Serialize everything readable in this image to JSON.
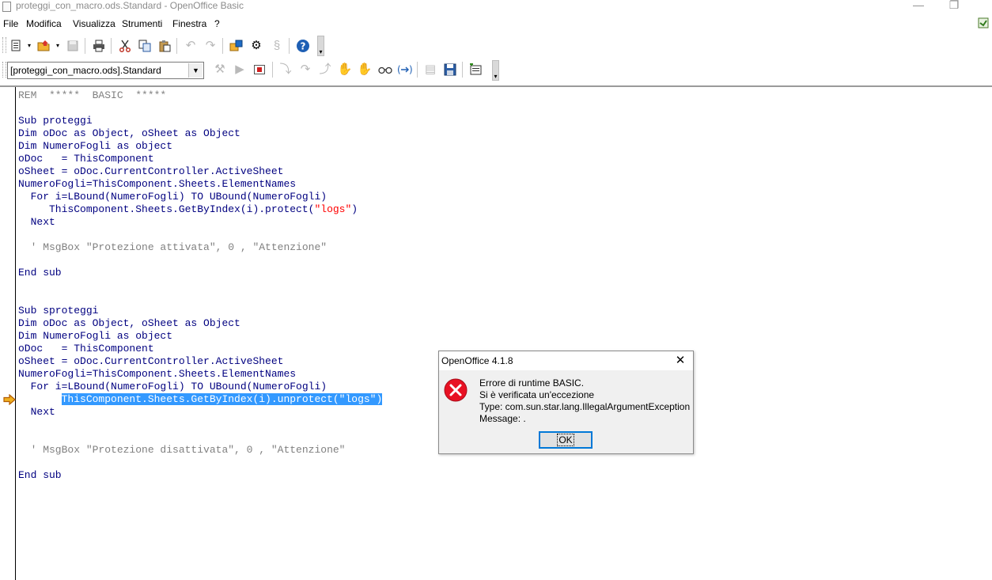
{
  "window": {
    "title": "proteggi_con_macro.ods.Standard - OpenOffice Basic",
    "minimize_glyph": "—",
    "restore_glyph": "❐"
  },
  "menu": [
    "File",
    "Modifica",
    "Visualizza",
    "Strumenti",
    "Finestra",
    "?"
  ],
  "toolbar2": {
    "library_value": "[proteggi_con_macro.ods].Standard"
  },
  "code": {
    "lines": [
      [
        {
          "t": "REM  *****  BASIC  *****",
          "c": "cm"
        }
      ],
      [],
      [
        {
          "t": "Sub proteggi",
          "c": "kw"
        }
      ],
      [
        {
          "t": "Dim oDoc as Object, oSheet as Object",
          "c": "kw"
        }
      ],
      [
        {
          "t": "Dim NumeroFogli as object",
          "c": "kw"
        }
      ],
      [
        {
          "t": "oDoc   = ThisComponent",
          "c": "kw"
        }
      ],
      [
        {
          "t": "oSheet = oDoc.CurrentController.ActiveSheet",
          "c": "kw"
        }
      ],
      [
        {
          "t": "NumeroFogli=ThisComponent.Sheets.ElementNames",
          "c": "kw"
        }
      ],
      [
        {
          "t": "  For i=LBound(NumeroFogli) TO UBound(NumeroFogli)",
          "c": "kw"
        }
      ],
      [
        {
          "t": "     ThisComponent.Sheets.GetByIndex(i).protect(",
          "c": "kw"
        },
        {
          "t": "\"logs\"",
          "c": "st"
        },
        {
          "t": ")",
          "c": "kw"
        }
      ],
      [
        {
          "t": "  Next",
          "c": "kw"
        }
      ],
      [],
      [
        {
          "t": "  ' MsgBox \"Protezione attivata\", 0 , \"Attenzione\"",
          "c": "cm"
        }
      ],
      [],
      [
        {
          "t": "End sub",
          "c": "kw"
        }
      ],
      [],
      [],
      [
        {
          "t": "Sub sproteggi",
          "c": "kw"
        }
      ],
      [
        {
          "t": "Dim oDoc as Object, oSheet as Object",
          "c": "kw"
        }
      ],
      [
        {
          "t": "Dim NumeroFogli as object",
          "c": "kw"
        }
      ],
      [
        {
          "t": "oDoc   = ThisComponent",
          "c": "kw"
        }
      ],
      [
        {
          "t": "oSheet = oDoc.CurrentController.ActiveSheet",
          "c": "kw"
        }
      ],
      [
        {
          "t": "NumeroFogli=ThisComponent.Sheets.ElementNames",
          "c": "kw"
        }
      ],
      [
        {
          "t": "  For i=LBound(NumeroFogli) TO UBound(NumeroFogli)",
          "c": "kw"
        }
      ],
      [
        {
          "t": "       ",
          "c": "kw"
        },
        {
          "t": "ThisComponent.Sheets.GetByIndex(i).unprotect(\"logs\")",
          "c": "sel"
        }
      ],
      [
        {
          "t": "  Next",
          "c": "kw"
        }
      ],
      [],
      [],
      [
        {
          "t": "  ' MsgBox \"Protezione disattivata\", 0 , \"Attenzione\"",
          "c": "cm"
        }
      ],
      [],
      [
        {
          "t": "End sub",
          "c": "kw"
        }
      ]
    ]
  },
  "dialog": {
    "title": "OpenOffice 4.1.8",
    "close_glyph": "✕",
    "message_lines": [
      "Errore di runtime BASIC.",
      "Si è verificata un'eccezione",
      "Type: com.sun.star.lang.IllegalArgumentException",
      "Message: ."
    ],
    "ok_label": "OK"
  },
  "colors": {
    "keyword": "#000080",
    "comment": "#808080",
    "string": "#ff0000",
    "selection": "#3399ff",
    "error_icon": "#e81123",
    "exec_arrow": "#e8a000",
    "focus_border": "#0078d7"
  }
}
